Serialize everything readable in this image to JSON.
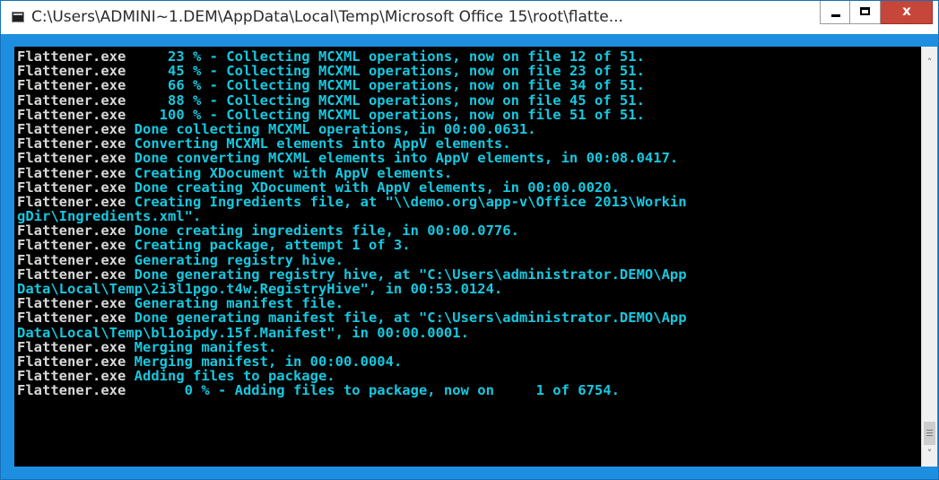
{
  "window": {
    "title": "C:\\Users\\ADMINI~1.DEM\\AppData\\Local\\Temp\\Microsoft Office 15\\root\\flatte...",
    "controls": {
      "minimize": "minimize",
      "maximize": "maximize",
      "close": "x"
    }
  },
  "colors": {
    "console_bg": "#000000",
    "process_text": "#d8d8d8",
    "message_text": "#16c8e0",
    "close_button": "#c7463a",
    "frame": "#1e8fe0"
  },
  "console": {
    "lines": [
      {
        "proc": "Flattener.exe",
        "msg": "     23 % - Collecting MCXML operations, now on file 12 of 51."
      },
      {
        "proc": "Flattener.exe",
        "msg": "     45 % - Collecting MCXML operations, now on file 23 of 51."
      },
      {
        "proc": "Flattener.exe",
        "msg": "     66 % - Collecting MCXML operations, now on file 34 of 51."
      },
      {
        "proc": "Flattener.exe",
        "msg": "     88 % - Collecting MCXML operations, now on file 45 of 51."
      },
      {
        "proc": "Flattener.exe",
        "msg": "    100 % - Collecting MCXML operations, now on file 51 of 51."
      },
      {
        "proc": "Flattener.exe",
        "msg": " Done collecting MCXML operations, in 00:00.0631."
      },
      {
        "proc": "Flattener.exe",
        "msg": " Converting MCXML elements into AppV elements."
      },
      {
        "proc": "Flattener.exe",
        "msg": " Done converting MCXML elements into AppV elements, in 00:08.0417."
      },
      {
        "proc": "Flattener.exe",
        "msg": " Creating XDocument with AppV elements."
      },
      {
        "proc": "Flattener.exe",
        "msg": " Done creating XDocument with AppV elements, in 00:00.0020."
      },
      {
        "proc": "Flattener.exe",
        "msg": " Creating Ingredients file, at \"\\\\demo.org\\app-v\\Office 2013\\Workin"
      },
      {
        "proc": "",
        "msg": "gDir\\Ingredients.xml\"."
      },
      {
        "proc": "Flattener.exe",
        "msg": " Done creating ingredients file, in 00:00.0776."
      },
      {
        "proc": "Flattener.exe",
        "msg": " Creating package, attempt 1 of 3."
      },
      {
        "proc": "Flattener.exe",
        "msg": " Generating registry hive."
      },
      {
        "proc": "Flattener.exe",
        "msg": " Done generating registry hive, at \"C:\\Users\\administrator.DEMO\\App"
      },
      {
        "proc": "",
        "msg": "Data\\Local\\Temp\\2i3l1pgo.t4w.RegistryHive\", in 00:53.0124."
      },
      {
        "proc": "Flattener.exe",
        "msg": " Generating manifest file."
      },
      {
        "proc": "Flattener.exe",
        "msg": " Done generating manifest file, at \"C:\\Users\\administrator.DEMO\\App"
      },
      {
        "proc": "",
        "msg": "Data\\Local\\Temp\\bl1oipdy.15f.Manifest\", in 00:00.0001."
      },
      {
        "proc": "Flattener.exe",
        "msg": " Merging manifest."
      },
      {
        "proc": "Flattener.exe",
        "msg": " Merging manifest, in 00:00.0004."
      },
      {
        "proc": "Flattener.exe",
        "msg": " Adding files to package."
      },
      {
        "proc": "Flattener.exe",
        "msg": "       0 % - Adding files to package, now on     1 of 6754."
      }
    ]
  },
  "scrollbar": {
    "up_icon": "chevron-up-icon",
    "down_icon": "chevron-down-icon"
  }
}
